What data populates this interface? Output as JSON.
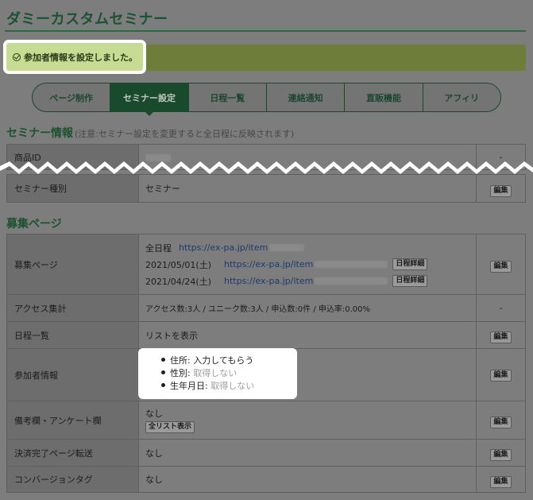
{
  "page": {
    "title": "ダミーカスタムセミナー"
  },
  "notice": {
    "text": "参加者情報を設定しました。"
  },
  "tabs": [
    {
      "label": "ページ制作",
      "active": false
    },
    {
      "label": "セミナー設定",
      "active": true
    },
    {
      "label": "日程一覧",
      "active": false
    },
    {
      "label": "連絡通知",
      "active": false
    },
    {
      "label": "直販機能",
      "active": false
    },
    {
      "label": "アフィリ",
      "active": false
    }
  ],
  "seminar_info": {
    "title": "セミナー情報",
    "note": "(注意:セミナー設定を変更すると全日程に反映されます)",
    "rows": [
      {
        "label": "商品ID",
        "value": "",
        "action": "-"
      },
      {
        "label": "セミナー種別",
        "value": "セミナー",
        "action": "編集"
      }
    ]
  },
  "recruit": {
    "title": "募集ページ",
    "page_row": {
      "label": "募集ページ",
      "all_label": "全日程",
      "url_prefix": "https://ex-pa.jp/item",
      "url_prefix_short": "https://ex-pa.jp/item",
      "dates": [
        {
          "date": "2021/05/01(土)",
          "detail": "日程詳細"
        },
        {
          "date": "2021/04/24(土)",
          "detail": "日程詳細"
        }
      ],
      "action": "編集"
    },
    "access_row": {
      "label": "アクセス集計",
      "value": "アクセス数:3人 / ユニーク数:3人 / 申込数:0件 / 申込率:0.00%",
      "action": "-"
    },
    "schedule_row": {
      "label": "日程一覧",
      "value": "リストを表示",
      "action": "編集"
    },
    "participant_row": {
      "label": "参加者情報",
      "action": "編集",
      "items": [
        {
          "key": "住所:",
          "value": "入力してもらう",
          "muted": false
        },
        {
          "key": "性別:",
          "value": "取得しない",
          "muted": true
        },
        {
          "key": "生年月日:",
          "value": "取得しない",
          "muted": true
        }
      ]
    },
    "remarks_row": {
      "label": "備考欄・アンケート欄",
      "value": "なし",
      "list_button": "全リスト表示",
      "action": "編集"
    },
    "redirect_row": {
      "label": "決済完了ページ転送",
      "value": "なし",
      "action": "編集"
    },
    "conversion_row": {
      "label": "コンバージョンタグ",
      "value": "なし",
      "action": "編集"
    }
  },
  "colors": {
    "accent": "#1a4a2c",
    "notice_bg": "#c5dc92",
    "dim_bg": "#7d7d7d",
    "link": "#1d3a6e"
  }
}
